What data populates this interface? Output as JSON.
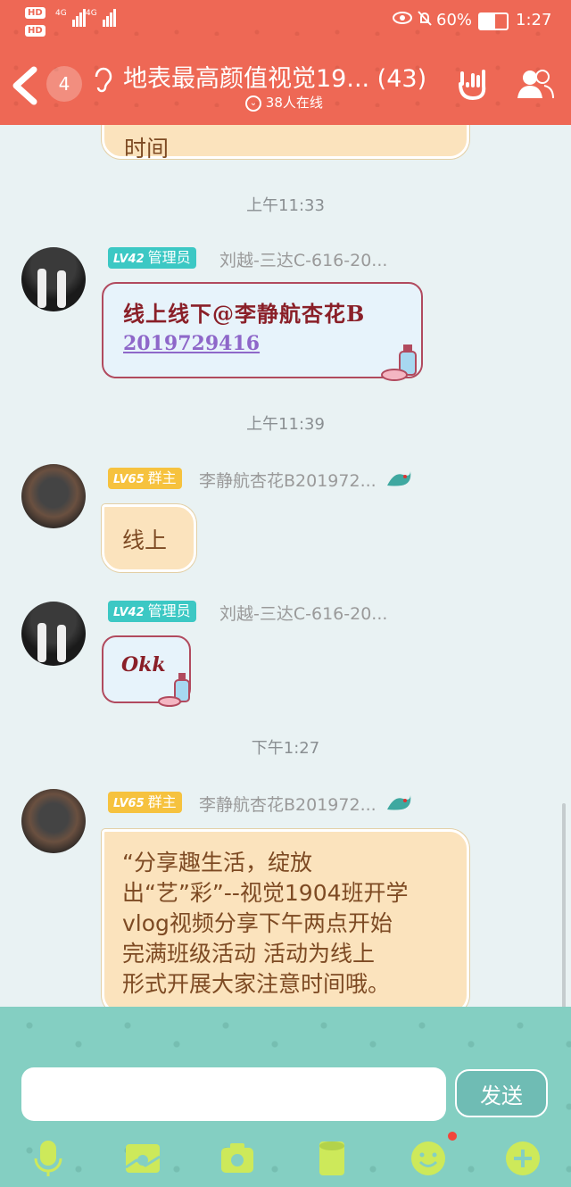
{
  "status_bar": {
    "hd_labels": [
      "HD",
      "HD"
    ],
    "network_labels": [
      "4G",
      "4G"
    ],
    "battery_percent": "60%",
    "time": "1:27"
  },
  "header": {
    "unread_count": "4",
    "title": "地表最高颜值视觉19... (43)",
    "online": "38人在线"
  },
  "messages": {
    "partial_text": "时间",
    "time1": "上午11:33",
    "m1": {
      "level": "LV42",
      "role": "管理员",
      "sender": "刘越-三达C-616-20...",
      "line1": "线上线下@李静航杏花B",
      "line2": "2019729416"
    },
    "time2": "上午11:39",
    "m2": {
      "level": "LV65",
      "role": "群主",
      "sender": "李静航杏花B201972...",
      "text": "线上"
    },
    "m3": {
      "level": "LV42",
      "role": "管理员",
      "sender": "刘越-三达C-616-20...",
      "text": "Okk"
    },
    "time3": "下午1:27",
    "m4": {
      "level": "LV65",
      "role": "群主",
      "sender": "李静航杏花B201972...",
      "lines": [
        "“分享趣生活，绽放",
        "出“艺”彩”--视觉1904班开学",
        "vlog视频分享下午两点开始",
        "完满班级活动  活动为线上",
        "形式开展大家注意时间哦。"
      ]
    }
  },
  "input": {
    "placeholder": "",
    "send_label": "发送"
  },
  "toolbar": {
    "icons": [
      "microphone-icon",
      "image-icon",
      "camera-icon",
      "file-icon",
      "emoji-icon",
      "plus-icon"
    ]
  },
  "colors": {
    "header": "#ee6855",
    "bottom": "#84cfc2",
    "bubble": "#fbe3bd",
    "admin_badge": "#3cc8c4",
    "owner_badge": "#f6c23e"
  }
}
